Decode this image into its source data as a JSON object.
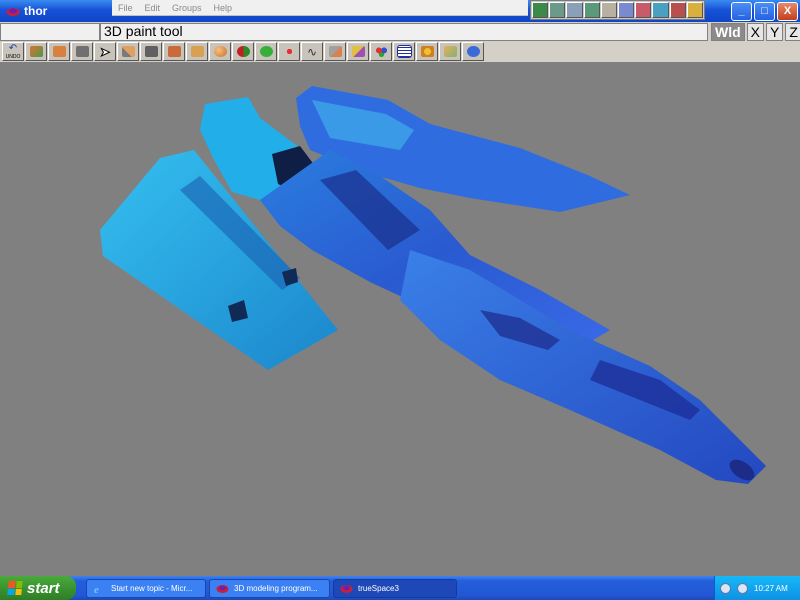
{
  "window": {
    "title": "thor",
    "menu": [
      "File",
      "Edit",
      "Groups",
      "Help"
    ],
    "controls": [
      "_",
      "□",
      "X"
    ]
  },
  "tool_panel": {
    "title": "3D paint tool",
    "axis_buttons": [
      "Wld",
      "X",
      "Y",
      "Z"
    ]
  },
  "toolbar": {
    "undo_label": "UNDO",
    "tool_icons": [
      "move-icon",
      "object-icon",
      "lathe-icon",
      "select-icon",
      "pencil-icon",
      "sweep-icon",
      "box-icon",
      "cube-icon",
      "sphere-icon",
      "paint-icon",
      "blob-icon",
      "light-icon",
      "path-icon",
      "brush-icon",
      "material-icon",
      "spheres-icon",
      "grid-icon",
      "render-icon",
      "plane-icon",
      "3d-icon"
    ]
  },
  "taskbar": {
    "start_label": "start",
    "tasks": [
      {
        "label": "Start new topic - Micr...",
        "icon": "ie-icon"
      },
      {
        "label": "3D modeling program...",
        "icon": "truespace-icon"
      },
      {
        "label": "trueSpace3",
        "icon": "truespace-icon",
        "active": true
      }
    ],
    "clock": "10:27 AM"
  },
  "colors": {
    "title_bar": "#1652d8",
    "viewport_background": "#808080",
    "model_light": "#2ab0ee",
    "model_dark": "#1a3aa8",
    "taskbar": "#245edb",
    "start_button": "#3a9330"
  }
}
